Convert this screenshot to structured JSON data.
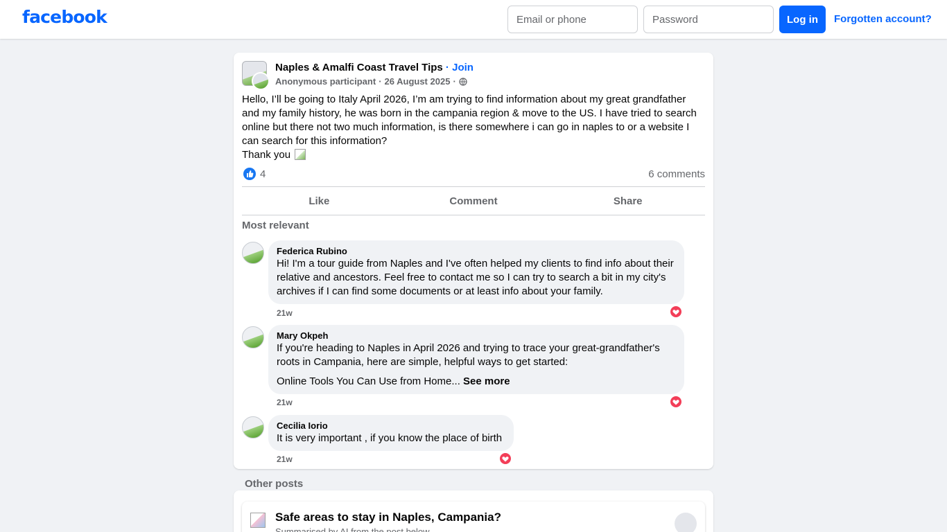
{
  "header": {
    "logo": "facebook",
    "email_placeholder": "Email or phone",
    "password_placeholder": "Password",
    "login_label": "Log in",
    "forgot_label": "Forgotten account?"
  },
  "post": {
    "group_name": "Naples & Amalfi Coast Travel Tips",
    "separator": " · ",
    "join_label": "Join",
    "author": "Anonymous participant",
    "date": "26 August 2025",
    "body": "Hello, I’ll be going to Italy April 2026, I’m am trying to find information about my great grandfather and my family history, he was born in the campania region & move to the US. I have tried to search online but there not two much information, is there somewhere i can go in naples to or a website I can search for this information?",
    "body_thanks": "Thank you",
    "reaction_count": "4",
    "comments_count": "6 comments",
    "actions": {
      "like": "Like",
      "comment": "Comment",
      "share": "Share"
    },
    "sort_label": "Most relevant",
    "accent_color": "#0866ff"
  },
  "comments": [
    {
      "author": "Federica Rubino",
      "text": "Hi! I'm a tour guide from Naples and I've often helped my clients to find info about their relative and ancestors. Feel free to contact me so I can try to search a bit in my city's archives if I can find some documents or at least info about your family.",
      "time": "21w",
      "reaction": "heart-icon"
    },
    {
      "author": "Mary Okpeh",
      "text": "If you're heading to Naples in April 2026 and trying to trace your great-grandfather's roots in Campania, here are simple, helpful ways to get started:",
      "text_2": "Online Tools You Can Use from Home...",
      "see_more": "See more",
      "time": "21w",
      "reaction": "heart-icon"
    },
    {
      "author": "Cecilia Iorio",
      "text": "It is very important , if you know the place of birth",
      "time": "21w",
      "reaction": "heart-icon"
    }
  ],
  "other_posts": {
    "label": "Other posts",
    "items": [
      {
        "title": "Safe areas to stay in Naples, Campania?",
        "subtitle": "Summarised by AI from the post below"
      }
    ]
  }
}
